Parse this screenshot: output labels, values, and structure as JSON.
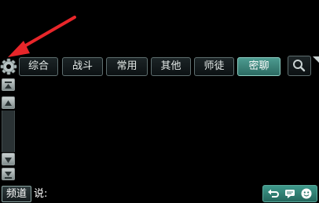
{
  "tabs": [
    {
      "label": "综合"
    },
    {
      "label": "战斗"
    },
    {
      "label": "常用"
    },
    {
      "label": "其他"
    },
    {
      "label": "师徒"
    },
    {
      "label": "密聊"
    }
  ],
  "active_tab": "密聊",
  "bottom_bar": {
    "channel_label": "频道",
    "say_label": "说:"
  },
  "icons": {
    "settings": "gear-icon",
    "search": "search-icon",
    "scroll_top": "scroll-top-icon",
    "scroll_up": "scroll-up-icon",
    "scroll_down": "scroll-down-icon",
    "scroll_bottom": "scroll-bottom-icon",
    "undo": "undo-icon",
    "chat": "chat-icon",
    "emoji": "emoji-icon"
  },
  "colors": {
    "background": "#000000",
    "active_tab": "#3f8a80",
    "annotation_arrow": "#e8262a"
  }
}
